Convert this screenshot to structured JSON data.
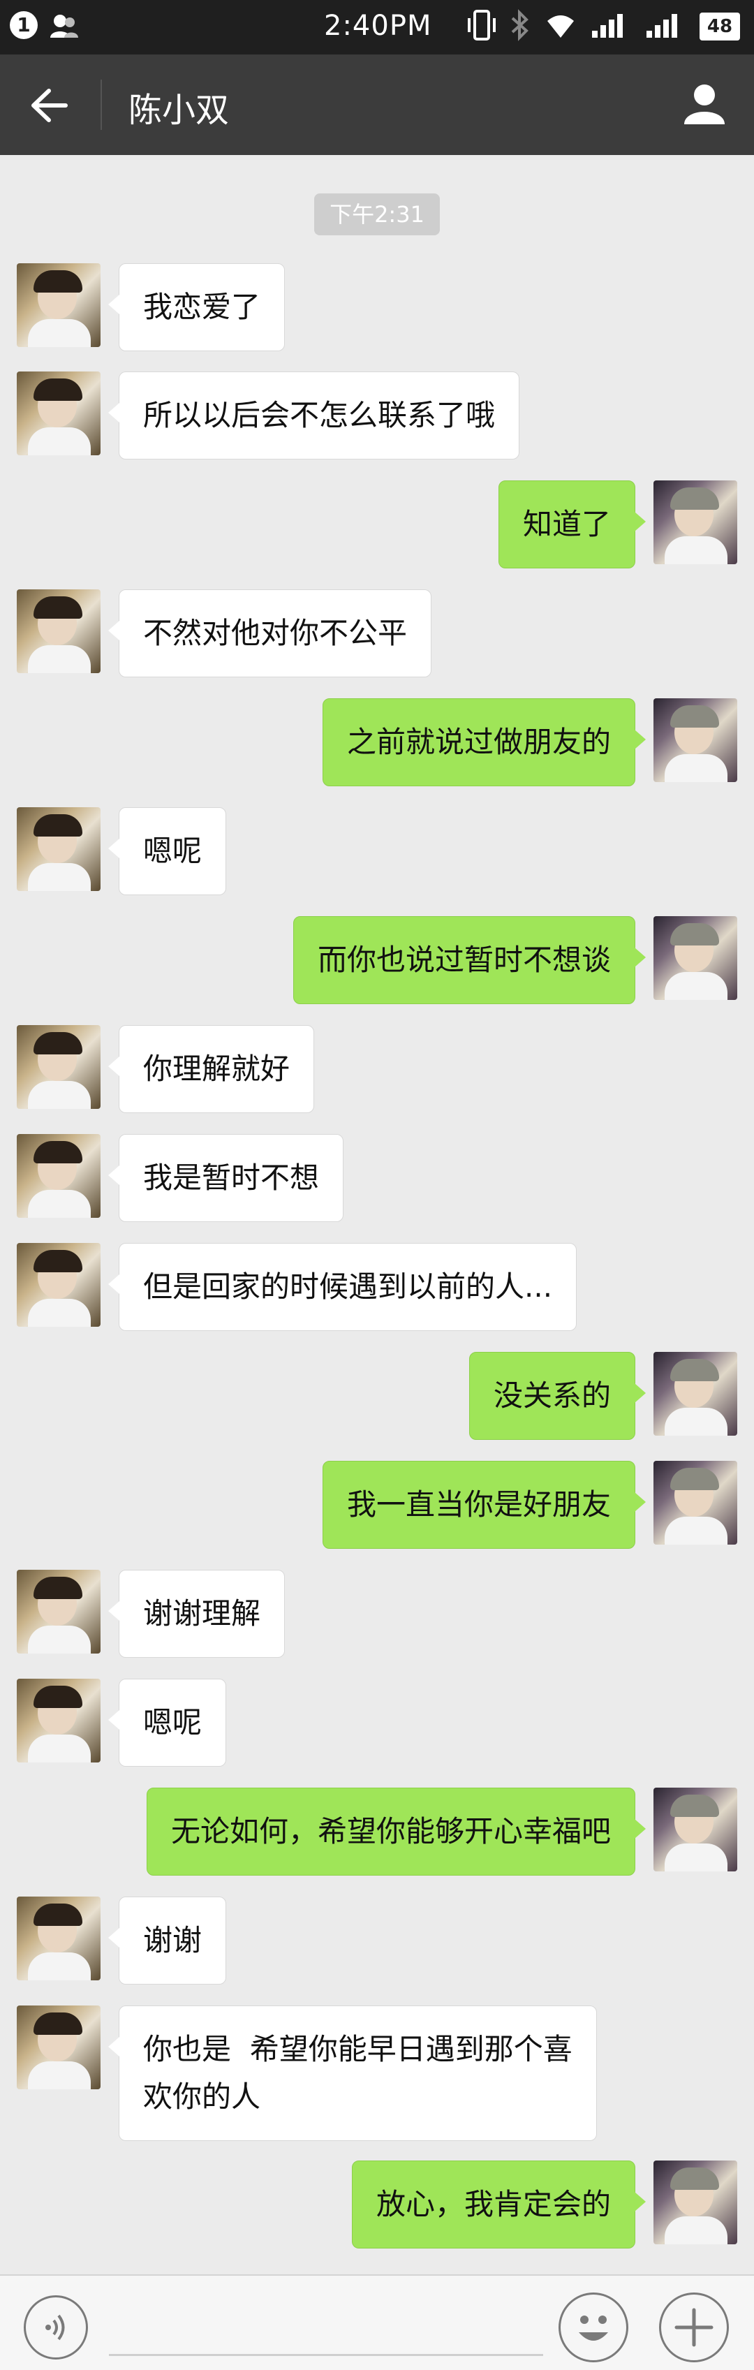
{
  "status_bar": {
    "notification_count": "1",
    "time": "2:40PM",
    "battery": "48",
    "icons": [
      "person-icon",
      "vibrate-icon",
      "bluetooth-icon",
      "wifi-icon",
      "signal-icon",
      "signal-icon"
    ]
  },
  "header": {
    "title": "陈小双",
    "back_icon": "arrow-left-icon",
    "profile_icon": "person-icon"
  },
  "chat": {
    "timestamp": "下午2:31",
    "messages": [
      {
        "side": "left",
        "text": "我恋爱了"
      },
      {
        "side": "left",
        "text": "所以以后会不怎么联系了哦"
      },
      {
        "side": "right",
        "text": "知道了"
      },
      {
        "side": "left",
        "text": "不然对他对你不公平"
      },
      {
        "side": "right",
        "text": "之前就说过做朋友的"
      },
      {
        "side": "left",
        "text": "嗯呢"
      },
      {
        "side": "right",
        "text": "而你也说过暂时不想谈"
      },
      {
        "side": "left",
        "text": "你理解就好"
      },
      {
        "side": "left",
        "text": "我是暂时不想"
      },
      {
        "side": "left",
        "text": "但是回家的时候遇到以前的人..."
      },
      {
        "side": "right",
        "text": "没关系的"
      },
      {
        "side": "right",
        "text": "我一直当你是好朋友"
      },
      {
        "side": "left",
        "text": "谢谢理解"
      },
      {
        "side": "left",
        "text": "嗯呢"
      },
      {
        "side": "right",
        "text": "无论如何，希望你能够开心幸福吧"
      },
      {
        "side": "left",
        "text": "谢谢"
      },
      {
        "side": "left",
        "text": "你也是  希望你能早日遇到那个喜\n欢你的人"
      },
      {
        "side": "right",
        "text": "放心，我肯定会的"
      }
    ]
  },
  "bottom_bar": {
    "voice_icon": "voice-icon",
    "emoji_icon": "emoji-icon",
    "plus_icon": "plus-icon"
  }
}
